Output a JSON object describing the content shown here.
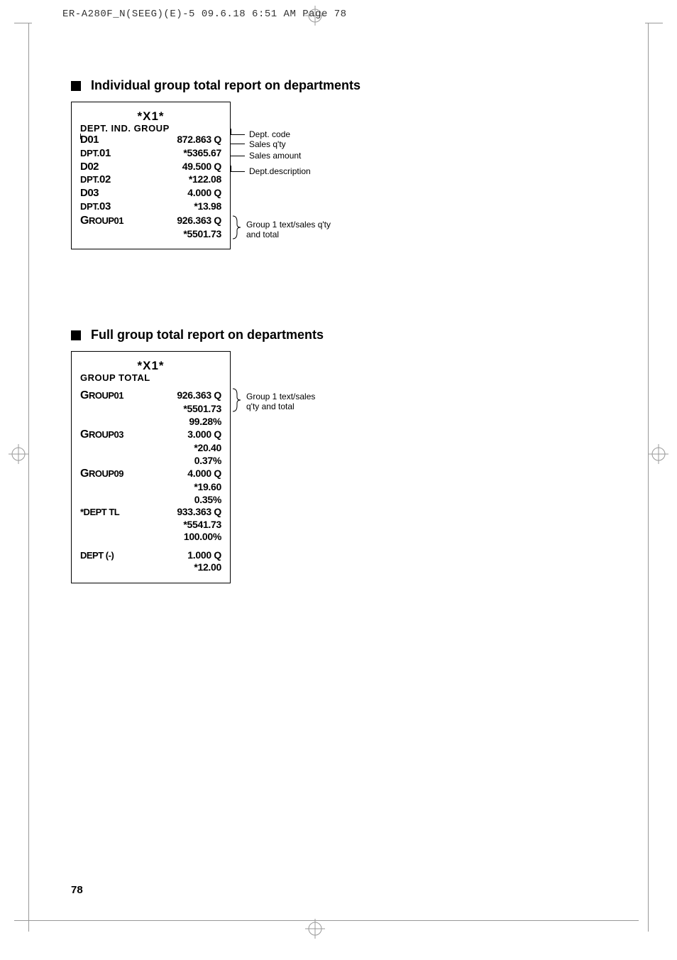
{
  "header": "ER-A280F_N(SEEG)(E)-5  09.6.18 6:51 AM  Page 78",
  "page_number": "78",
  "section1": {
    "title": "Individual group total report on departments",
    "receipt": {
      "star_header": "*X1*",
      "sub_header": "DEPT. IND. GROUP",
      "rows": [
        {
          "left": "D01",
          "right": "872.863 Q",
          "style": "big"
        },
        {
          "left_prefix": "DPT.",
          "left_num": "01",
          "right": "*5365.67",
          "style": "dpt"
        },
        {
          "left": "D02",
          "right": "49.500 Q",
          "style": "big"
        },
        {
          "left_prefix": "DPT.",
          "left_num": "02",
          "right": "*122.08",
          "style": "dpt"
        },
        {
          "left": "D03",
          "right": "4.000 Q",
          "style": "big"
        },
        {
          "left_prefix": "DPT.",
          "left_num": "03",
          "right": "*13.98",
          "style": "dpt"
        },
        {
          "left": "GROUP01",
          "right": "926.363 Q",
          "style": "grp"
        },
        {
          "left": "",
          "right": "*5501.73",
          "style": "plain"
        }
      ]
    },
    "annotations": {
      "dept_code": "Dept. code",
      "sales_qty": "Sales q'ty",
      "sales_amount": "Sales amount",
      "dept_desc": "Dept.description",
      "group1": "Group 1 text/sales q'ty",
      "group1b": "and total"
    }
  },
  "section2": {
    "title": "Full group total report on departments",
    "receipt": {
      "star_header": "*X1*",
      "sub_header": "GROUP TOTAL",
      "rows": [
        {
          "spacer": true
        },
        {
          "left": "GROUP01",
          "right": "926.363 Q",
          "style": "grp"
        },
        {
          "left": "",
          "right": "*5501.73",
          "style": "plain"
        },
        {
          "left": "",
          "right": "99.28%",
          "style": "plain"
        },
        {
          "left": "GROUP03",
          "right": "3.000 Q",
          "style": "grp"
        },
        {
          "left": "",
          "right": "*20.40",
          "style": "plain"
        },
        {
          "left": "",
          "right": "0.37%",
          "style": "plain"
        },
        {
          "left": "GROUP09",
          "right": "4.000 Q",
          "style": "grp"
        },
        {
          "left": "",
          "right": "*19.60",
          "style": "plain"
        },
        {
          "left": "",
          "right": "0.35%",
          "style": "plain"
        },
        {
          "left": "*DEPT TL",
          "right": "933.363 Q",
          "style": "plain-left"
        },
        {
          "left": "",
          "right": "*5541.73",
          "style": "plain"
        },
        {
          "left": "",
          "right": "100.00%",
          "style": "plain"
        },
        {
          "spacer": true
        },
        {
          "left": "DEPT (-)",
          "right": "1.000 Q",
          "style": "plain-left"
        },
        {
          "left": "",
          "right": "*12.00",
          "style": "plain"
        }
      ]
    },
    "annotations": {
      "group1": "Group 1 text/sales",
      "group1b": "q'ty and total"
    }
  }
}
